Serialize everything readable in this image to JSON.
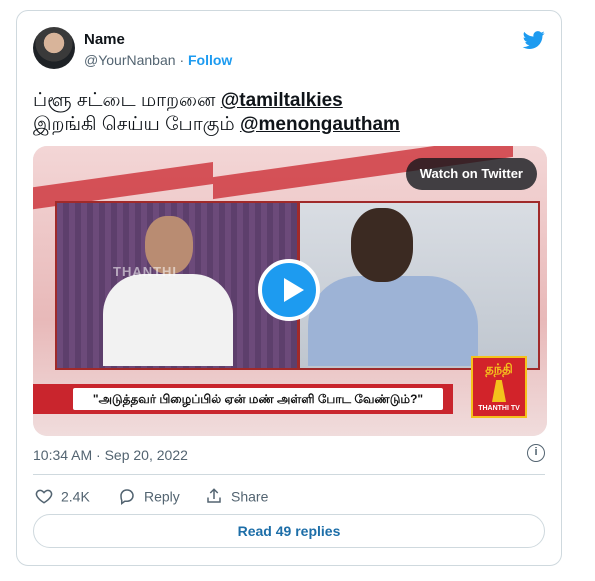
{
  "user": {
    "name": "Name",
    "handle": "@YourNanban",
    "separator": "·",
    "follow_label": "Follow"
  },
  "tweet": {
    "line1_text": "ப்ளூ சட்டை மாறனை ",
    "line1_mention": "@tamiltalkies",
    "line2_text": "இறங்கி செய்ய போகும் ",
    "line2_mention": "@menongautham"
  },
  "media": {
    "watch_label": "Watch on Twitter",
    "ticker_text": "\"அடுத்தவர் பிழைப்பில் ஏன் மண் அள்ளி போட வேண்டும்?\"",
    "watermark_text": "THANTHI",
    "logo_top": "தந்தி",
    "logo_bottom": "THANTHI TV"
  },
  "timestamp": "10:34 AM · Sep 20, 2022",
  "info_glyph": "i",
  "actions": {
    "likes": "2.4K",
    "reply_label": "Reply",
    "share_label": "Share"
  },
  "read_replies_label": "Read 49 replies",
  "colors": {
    "accent": "#1d9bf0",
    "text": "#0f1419",
    "muted": "#536471",
    "border": "#cfd9de",
    "channel_red": "#c9252d"
  }
}
